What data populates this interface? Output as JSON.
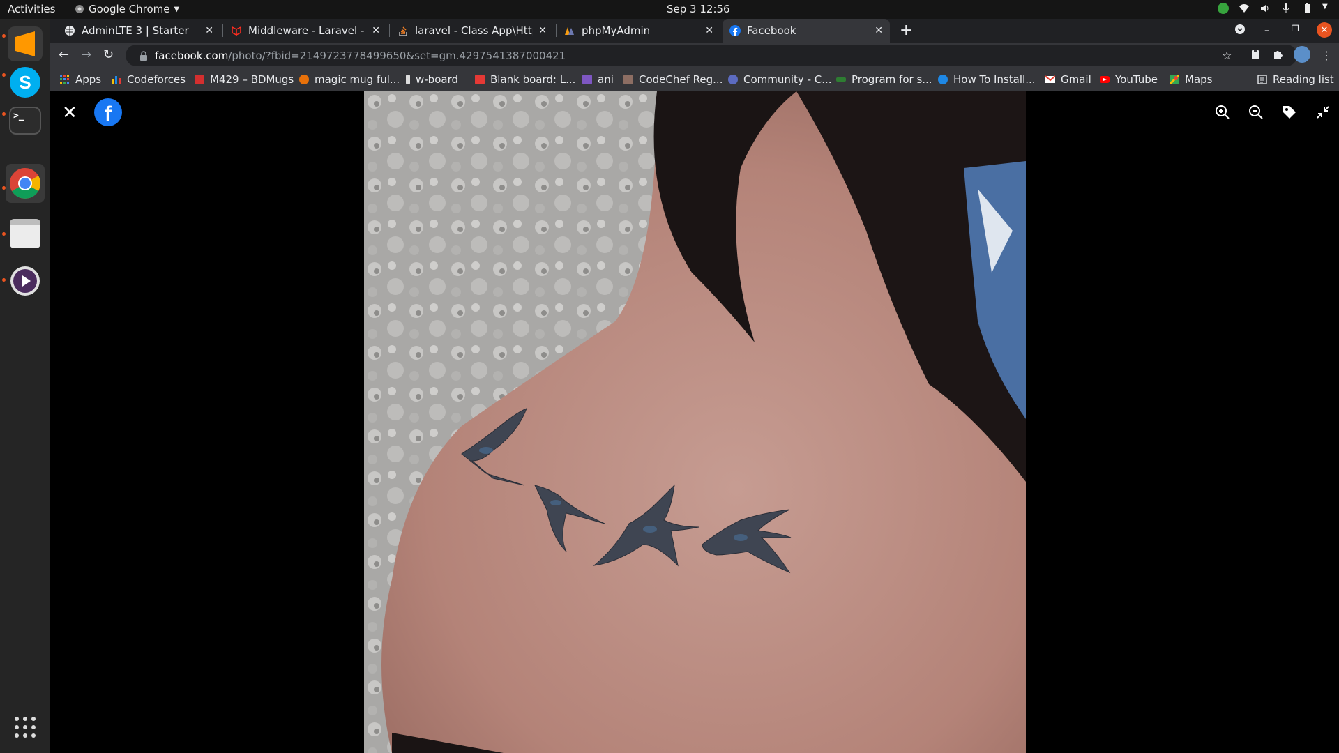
{
  "topbar": {
    "activities": "Activities",
    "app_menu": "Google Chrome",
    "clock": "Sep 3  12:56"
  },
  "dock": {
    "items": [
      {
        "name": "sublime-text",
        "color": "#3a3a3a"
      },
      {
        "name": "skype",
        "color": "#00aff0"
      },
      {
        "name": "terminal",
        "color": "#2c2c2c"
      },
      {
        "name": "chrome",
        "color": "#3a3a3a"
      },
      {
        "name": "files",
        "color": "#d8d8d8"
      },
      {
        "name": "media-player",
        "color": "#4b2c5e"
      }
    ]
  },
  "tabs": [
    {
      "title": "AdminLTE 3 | Starter",
      "icon": "globe-icon"
    },
    {
      "title": "Middleware - Laravel - The",
      "icon": "laravel-icon"
    },
    {
      "title": "laravel - Class App\\Http\\M",
      "icon": "stackoverflow-icon"
    },
    {
      "title": "phpMyAdmin",
      "icon": "phpmyadmin-icon"
    },
    {
      "title": "Facebook",
      "icon": "facebook-icon"
    }
  ],
  "address": {
    "host": "facebook.com",
    "path": "/photo/?fbid=2149723778499650&set=gm.4297541387000421"
  },
  "bookmarks": [
    {
      "label": "Apps",
      "color": "#4285f4"
    },
    {
      "label": "Codeforces",
      "color": "#f4c20d"
    },
    {
      "label": "M429 – BDMugs",
      "color": "#d32f2f"
    },
    {
      "label": "magic mug ful...",
      "color": "#e8710a"
    },
    {
      "label": "w-board",
      "color": "#dddddd"
    },
    {
      "label": "Blank board: L...",
      "color": "#e53935"
    },
    {
      "label": "ani",
      "color": "#7e57c2"
    },
    {
      "label": "CodeChef Reg...",
      "color": "#8d6e63"
    },
    {
      "label": "Community - C...",
      "color": "#5c6bc0"
    },
    {
      "label": "Program for s...",
      "color": "#2e7d32"
    },
    {
      "label": "How To Install...",
      "color": "#1e88e5"
    },
    {
      "label": "Gmail",
      "color": "#ea4335"
    },
    {
      "label": "YouTube",
      "color": "#ff0000"
    },
    {
      "label": "Maps",
      "color": "#34a853"
    }
  ],
  "reading_list": "Reading list",
  "viewer": {
    "close": "✕",
    "logo": "f"
  }
}
